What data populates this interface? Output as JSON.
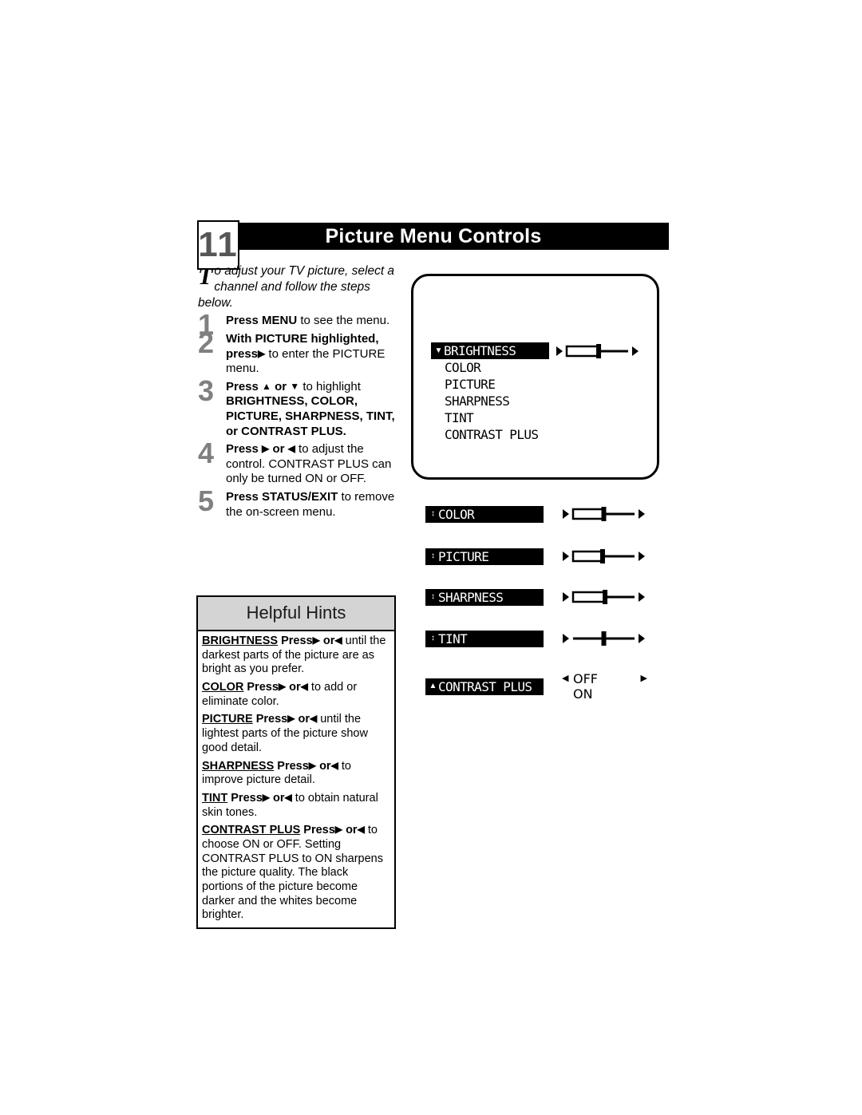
{
  "header": {
    "chapter_number": "11",
    "title": "Picture Menu Controls"
  },
  "intro": {
    "dropcap": "T",
    "text": "o adjust your TV picture, select a channel and follow the steps below."
  },
  "steps": [
    {
      "number": "1",
      "bold_lead": "Press MENU",
      "rest": " to see the menu."
    },
    {
      "number": "2",
      "bold_lead": "With PICTURE highlighted, press",
      "arrow": "▶",
      "rest": " to enter the PICTURE menu."
    },
    {
      "number": "3",
      "bold_lead": "Press",
      "arrow_up": "▲",
      "or_text": "or",
      "arrow_down": "▼",
      "mid": " to highlight ",
      "bold_tail": "BRIGHTNESS, COLOR, PICTURE, SHARPNESS, TINT, or CONTRAST PLUS."
    },
    {
      "number": "4",
      "bold_lead": "Press",
      "arrow_r": "▶",
      "or_text": "or",
      "arrow_l": "◀",
      "rest": " to adjust the control.",
      "extra": "CONTRAST PLUS can only be turned ON or OFF."
    },
    {
      "number": "5",
      "bold_lead": "Press STATUS/EXIT",
      "rest": " to remove the on-screen menu."
    }
  ],
  "hints": {
    "title": "Helpful Hints",
    "items": [
      {
        "term": "BRIGHTNESS",
        "bold_press": "Press",
        "arrow_r": "▶",
        "or_text": "or",
        "arrow_l": "◀",
        "body": " until the darkest parts of the picture are as bright as you prefer."
      },
      {
        "term": "COLOR",
        "bold_press": "Press",
        "arrow_r": "▶",
        "or_text": "or",
        "arrow_l": "◀",
        "body": " to add or eliminate color."
      },
      {
        "term": "PICTURE",
        "bold_press": "Press",
        "arrow_r": "▶",
        "or_text": "or",
        "arrow_l": "◀",
        "body": " until the lightest parts of the picture show good detail."
      },
      {
        "term": "SHARPNESS",
        "bold_press": "Press",
        "arrow_r": "▶",
        "or_text": "or",
        "arrow_l": "◀",
        "body": " to improve picture detail."
      },
      {
        "term": "TINT",
        "bold_press": "Press",
        "arrow_r": "▶",
        "or_text": "or",
        "arrow_l": "◀",
        "body": " to obtain natural skin tones."
      },
      {
        "term": "CONTRAST PLUS",
        "bold_press": "Press",
        "arrow_r": "▶",
        "or_text": "or",
        "arrow_l": "◀",
        "body": " to choose ON or OFF. Setting CONTRAST PLUS to ON sharpens the picture quality. The black portions of the picture become darker and the whites become brighter."
      }
    ]
  },
  "tv_menu": {
    "items": [
      {
        "label": "BRIGHTNESS",
        "highlighted": true,
        "caret": "▼"
      },
      {
        "label": "COLOR",
        "highlighted": false,
        "caret": ""
      },
      {
        "label": "PICTURE",
        "highlighted": false,
        "caret": ""
      },
      {
        "label": "SHARPNESS",
        "highlighted": false,
        "caret": ""
      },
      {
        "label": "TINT",
        "highlighted": false,
        "caret": ""
      },
      {
        "label": "CONTRAST PLUS",
        "highlighted": false,
        "caret": ""
      }
    ],
    "brightness_slider": {
      "fill_percent": 52,
      "handle_percent": 52
    }
  },
  "detail_rows": [
    {
      "label": "COLOR",
      "caret": "↕",
      "fill_percent": 50,
      "handle_percent": 50,
      "type": "slider"
    },
    {
      "label": "PICTURE",
      "caret": "↕",
      "fill_percent": 48,
      "handle_percent": 48,
      "type": "slider"
    },
    {
      "label": "SHARPNESS",
      "caret": "↕",
      "fill_percent": 52,
      "handle_percent": 52,
      "type": "slider"
    },
    {
      "label": "TINT",
      "caret": "↕",
      "fill_percent": 0,
      "handle_percent": 50,
      "type": "line"
    },
    {
      "label": "CONTRAST PLUS",
      "caret": "▲",
      "type": "onoff",
      "options": "OFF\nON",
      "arrow_l": "◀",
      "arrow_r": "▶"
    }
  ],
  "colors": {
    "ink": "#000000",
    "hint_header_bg": "#d4d4d4",
    "step_number": "#808080",
    "chapter_number": "#565656"
  }
}
